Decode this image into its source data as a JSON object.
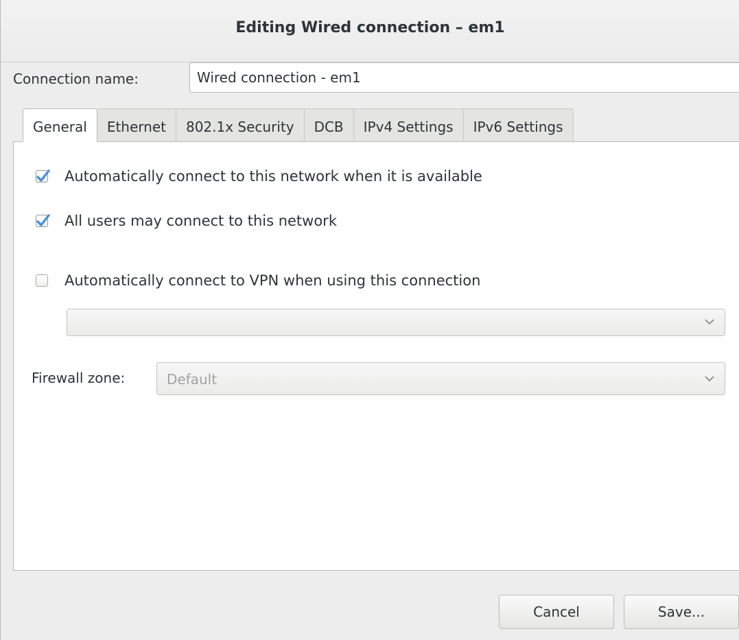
{
  "window": {
    "title": "Editing Wired connection – em1"
  },
  "connection": {
    "label": "Connection name:",
    "value": "Wired connection - em1"
  },
  "tabs": [
    {
      "label": "General",
      "active": true
    },
    {
      "label": "Ethernet"
    },
    {
      "label": "802.1x Security"
    },
    {
      "label": "DCB"
    },
    {
      "label": "IPv4 Settings"
    },
    {
      "label": "IPv6 Settings"
    }
  ],
  "general": {
    "auto_connect": {
      "label": "Automatically connect to this network when it is available",
      "checked": true
    },
    "all_users": {
      "label": "All users may connect to this network",
      "checked": true
    },
    "auto_vpn": {
      "label": "Automatically connect to VPN when using this connection",
      "checked": false
    },
    "vpn_select": {
      "value": ""
    },
    "firewall": {
      "label": "Firewall zone:",
      "value": "Default"
    }
  },
  "buttons": {
    "cancel": "Cancel",
    "save": "Save..."
  },
  "colors": {
    "check_accent": "#4a90d9",
    "panel_bg": "#ffffff",
    "window_bg": "#ededed"
  }
}
